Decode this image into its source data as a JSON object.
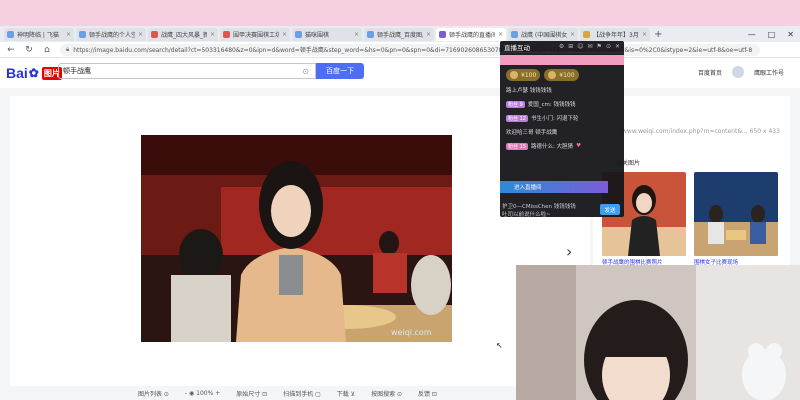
{
  "browser": {
    "tabs": [
      {
        "title": "神明降临 | 飞猫",
        "active": false
      },
      {
        "title": "顿手战鹰的个人空间",
        "active": false
      },
      {
        "title": "战鹰_四大风暴_新浪",
        "active": false
      },
      {
        "title": "围甲决赛围棋工坊",
        "active": false
      },
      {
        "title": "猫咪围棋",
        "active": false
      },
      {
        "title": "顿手战鹰_百度图片",
        "active": false
      },
      {
        "title": "顿手战鹰的直播间",
        "active": true
      },
      {
        "title": "战鹰 (中国围棋女子)",
        "active": false
      },
      {
        "title": "【战争年年】3月17日",
        "active": false
      }
    ],
    "new_tab": "+",
    "window_controls": [
      "—",
      "□",
      "✕"
    ],
    "url": "https://image.baidu.com/search/detail?ct=503316480&z=0&ipn=d&word=顿手战鹰&step_word=&hs=0&pn=0&spn=0&di=7169026086530785668&pi=0&rn=1&tn=baiduimagedetail&is=0%2C0&istype=2&ie=utf-8&oe=utf-8"
  },
  "site": {
    "logo_bai": "Bai",
    "logo_du": "du",
    "logo_img": "图片",
    "search_value": "顿手战鹰",
    "search_button": "百度一下",
    "home_link": "百度首页",
    "user_name": "鹰眼工作号"
  },
  "detail": {
    "source": "www.weiqi.com/index.php?m=content&...   650 x 433",
    "related_label": "相关图片",
    "thumb_captions": [
      "顿手战鹰的围棋比赛照片",
      "围棋女子比赛现场"
    ]
  },
  "bottom_toolbar": [
    "图片列表 ⊙",
    "- ◉ 100% +",
    "原始尺寸 ⊡",
    "扫描到手机 ▢",
    "下载 ⊻",
    "按图搜索 ⊙",
    "反馈 ⊡"
  ],
  "live_panel": {
    "title": "直播互动",
    "tools": [
      "⚙",
      "⊞",
      "☺",
      "✉",
      "⚑",
      "⊙",
      "✕"
    ],
    "gifts": [
      {
        "amount": "¥100"
      },
      {
        "amount": "¥100"
      }
    ],
    "messages": [
      {
        "badge": "",
        "text": "路上卢瑟  钱钱钱钱"
      },
      {
        "badge": "粉丝 9",
        "badge_style": "purple",
        "text": "爱国_cm: 钱钱钱钱"
      },
      {
        "badge": "粉丝 12",
        "badge_style": "purple",
        "text": "书生小门: 闪退下轮"
      },
      {
        "badge": "",
        "text": "欢迎哈三哥  顿手战鹰"
      },
      {
        "badge": "粉丝 15",
        "badge_style": "pink",
        "text": "路德什么: 大胆猜"
      }
    ],
    "banner": "进入直播间",
    "input_lines": [
      "护卫0—CMissChen 钱钱钱钱",
      "吐司以前说什么啦~"
    ],
    "send_button": "发送"
  },
  "colors": {
    "baidu_blue": "#2932e1",
    "search_button": "#4e6ef2",
    "top_band": "#f6cfe0",
    "panel_bg": "#16161a",
    "gift_gold": "#8a6f2a"
  }
}
